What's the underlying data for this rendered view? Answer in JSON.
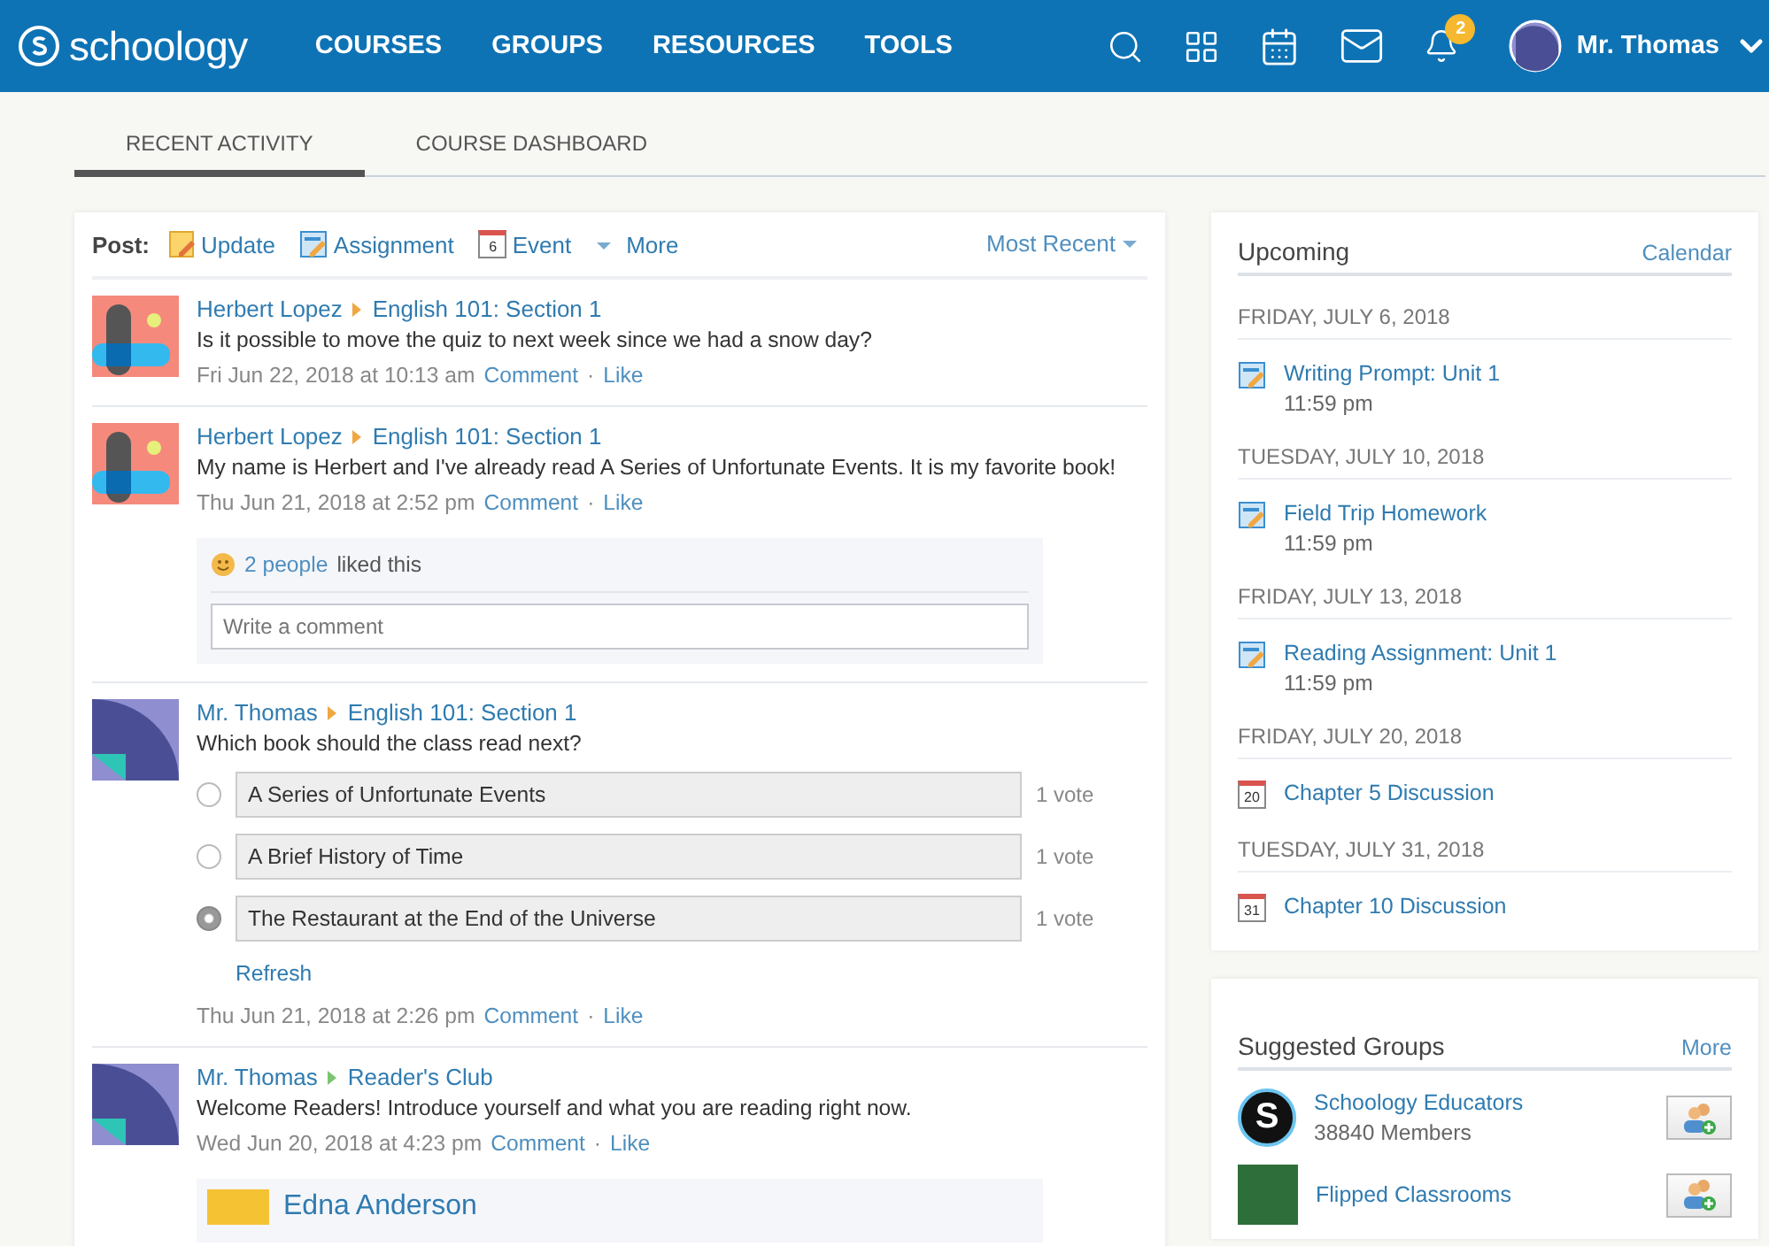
{
  "nav": {
    "brand": "schoology",
    "items": [
      {
        "label": "COURSES"
      },
      {
        "label": "GROUPS"
      },
      {
        "label": "RESOURCES"
      },
      {
        "label": "TOOLS"
      }
    ],
    "notification_count": "2",
    "user": "Mr. Thomas"
  },
  "tabs": [
    {
      "label": "RECENT ACTIVITY",
      "selected": true
    },
    {
      "label": "COURSE DASHBOARD",
      "selected": false
    }
  ],
  "post_bar": {
    "label": "Post:",
    "actions": [
      {
        "kind": "update",
        "label": "Update"
      },
      {
        "kind": "assignment",
        "label": "Assignment"
      },
      {
        "kind": "event",
        "label": "Event",
        "day": "6"
      },
      {
        "kind": "more",
        "label": "More"
      }
    ],
    "sort": "Most Recent"
  },
  "feed": [
    {
      "avatar": {
        "kind": "blocks"
      },
      "separator": "·",
      "author": "Herbert Lopez",
      "target": "English 101: Section 1",
      "color": "#f0a742",
      "text": "Is it possible to move the quiz to next week since we had a snow day?",
      "time": "Fri Jun 22, 2018 at 10:13 am",
      "comment": "Comment",
      "like": "Like"
    },
    {
      "avatar": {
        "kind": "blocks"
      },
      "separator": "·",
      "author": "Herbert Lopez",
      "target": "English 101: Section 1",
      "color": "#f0a742",
      "text": "My name is Herbert and I've already read A Series of Unfortunate Events. It is my favorite book!",
      "time": "Thu Jun 21, 2018 at 2:52 pm",
      "comment": "Comment",
      "like": "Like",
      "likes": {
        "people": "2 people",
        "text": "liked this"
      },
      "comment_placeholder": "Write a comment"
    },
    {
      "avatar": {
        "kind": "arc"
      },
      "separator": "·",
      "author": "Mr. Thomas",
      "target": "English 101: Section 1",
      "color": "#f0a742",
      "text": "Which book should the class read next?",
      "poll": {
        "options": [
          {
            "label": "A Series of Unfortunate Events",
            "votes": "1 vote",
            "selected": false
          },
          {
            "label": "A Brief History of Time",
            "votes": "1 vote",
            "selected": false
          },
          {
            "label": "The Restaurant at the End of the Universe",
            "votes": "1 vote",
            "selected": true
          }
        ],
        "refresh": "Refresh"
      },
      "time": "Thu Jun 21, 2018 at 2:26 pm",
      "comment": "Comment",
      "like": "Like"
    },
    {
      "avatar": {
        "kind": "arc"
      },
      "separator": "·",
      "author": "Mr. Thomas",
      "target": "Reader's Club",
      "color": "#7cc56f",
      "text": "Welcome Readers! Introduce yourself and what you are reading right now.",
      "time": "Wed Jun 20, 2018 at 4:23 pm",
      "comment": "Comment",
      "like": "Like",
      "replies": [
        {
          "author": "Edna Anderson"
        }
      ]
    }
  ],
  "upcoming": {
    "title": "Upcoming",
    "link": "Calendar",
    "days": [
      {
        "date": "FRIDAY, JULY 6, 2018",
        "items": [
          {
            "kind": "assignment",
            "title": "Writing Prompt: Unit 1",
            "time": "11:59 pm"
          }
        ]
      },
      {
        "date": "TUESDAY, JULY 10, 2018",
        "items": [
          {
            "kind": "assignment",
            "title": "Field Trip Homework",
            "time": "11:59 pm"
          }
        ]
      },
      {
        "date": "FRIDAY, JULY 13, 2018",
        "items": [
          {
            "kind": "assignment",
            "title": "Reading Assignment: Unit 1",
            "time": "11:59 pm"
          }
        ]
      },
      {
        "date": "FRIDAY, JULY 20, 2018",
        "items": [
          {
            "kind": "event",
            "title": "Chapter 5 Discussion",
            "day": "20"
          }
        ]
      },
      {
        "date": "TUESDAY, JULY 31, 2018",
        "items": [
          {
            "kind": "event",
            "title": "Chapter 10 Discussion",
            "day": "31"
          }
        ]
      }
    ]
  },
  "suggested_groups": {
    "title": "Suggested Groups",
    "link": "More",
    "groups": [
      {
        "kind": "letter",
        "letter": "S",
        "name": "Schoology Educators",
        "members": "38840 Members"
      },
      {
        "kind": "chalkboard",
        "name": "Flipped Classrooms"
      }
    ]
  }
}
